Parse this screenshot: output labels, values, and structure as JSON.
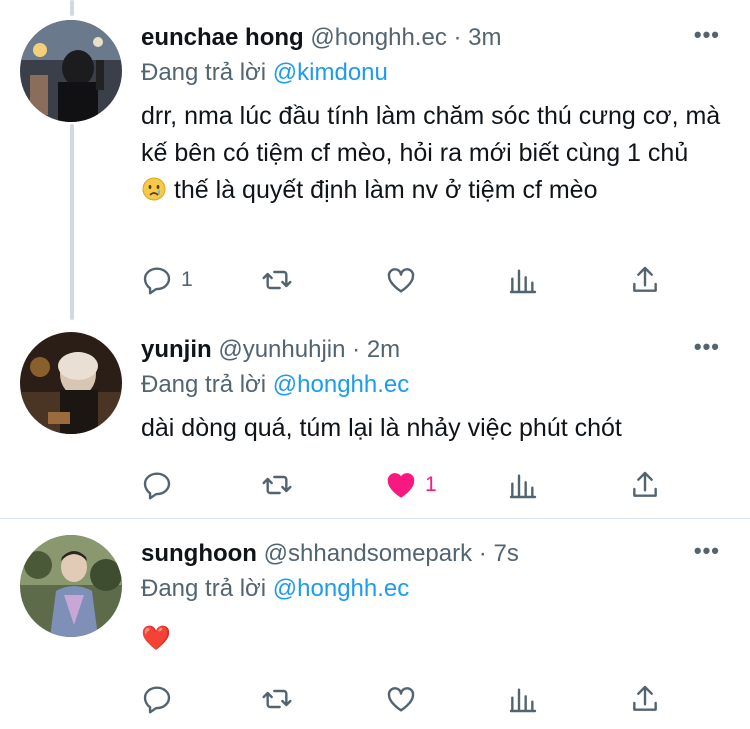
{
  "tweets": [
    {
      "name": "eunchae hong",
      "handle": "@honghh.ec",
      "dot": "·",
      "time": "3m",
      "more": "•••",
      "reply_prefix": "Đang trả lời",
      "reply_mention": "@kimdonu",
      "text_before_emoji": "drr, nma lúc đầu tính làm chăm sóc thú cưng cơ, mà kế bên có tiệm cf mèo, hỏi ra mới biết cùng 1 chủ",
      "emoji": "crying-face-emoji",
      "text_after_emoji": " thế là quyết định làm nv ở tiệm cf mèo",
      "reply_count": "1",
      "retweet_count": "",
      "like_count": "",
      "liked": false
    },
    {
      "name": "yunjin",
      "handle": "@yunhuhjin",
      "dot": "·",
      "time": "2m",
      "more": "•••",
      "reply_prefix": "Đang trả lời",
      "reply_mention": "@honghh.ec",
      "text": "dài dòng quá, túm lại là nhảy việc phút chót",
      "reply_count": "",
      "retweet_count": "",
      "like_count": "1",
      "liked": true
    },
    {
      "name": "sunghoon",
      "handle": "@shhandsomepark",
      "dot": "·",
      "time": "7s",
      "more": "•••",
      "reply_prefix": "Đang trả lời",
      "reply_mention": "@honghh.ec",
      "text": "❤️",
      "reply_count": "",
      "retweet_count": "",
      "like_count": "",
      "liked": false
    }
  ],
  "colors": {
    "text": "#0f1419",
    "secondary": "#536471",
    "link": "#1d9bf0",
    "like": "#f91880",
    "divider": "#e1e8ed"
  },
  "icons": [
    "reply-icon",
    "retweet-icon",
    "like-icon",
    "analytics-icon",
    "share-icon",
    "more-icon"
  ]
}
